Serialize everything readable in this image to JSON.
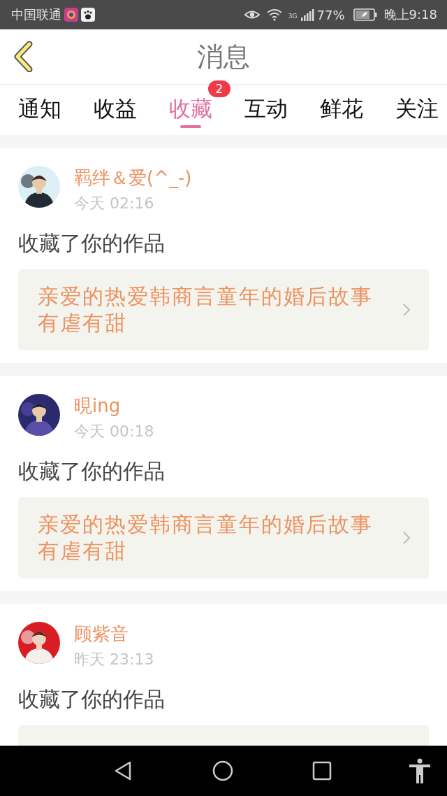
{
  "status_bar": {
    "carrier": "中国联通",
    "network": "3G",
    "battery": "77%",
    "time": "晚上9:18"
  },
  "header": {
    "title": "消息"
  },
  "tabs": [
    {
      "label": "通知",
      "selected": false
    },
    {
      "label": "收益",
      "selected": false
    },
    {
      "label": "收藏",
      "selected": true,
      "badge": "2"
    },
    {
      "label": "互动",
      "selected": false
    },
    {
      "label": "鲜花",
      "selected": false
    },
    {
      "label": "关注",
      "selected": false
    }
  ],
  "posts": [
    {
      "user": "羁绊＆爱(^_-)",
      "time": "今天 02:16",
      "action": "收藏了你的作品",
      "work": "亲爱的热爱韩商言童年的婚后故事有虐有甜"
    },
    {
      "user": "晛ing",
      "time": "今天 00:18",
      "action": "收藏了你的作品",
      "work": "亲爱的热爱韩商言童年的婚后故事有虐有甜"
    },
    {
      "user": "顾紫音",
      "time": "昨天 23:13",
      "action": "收藏了你的作品",
      "truncated": true
    }
  ]
}
